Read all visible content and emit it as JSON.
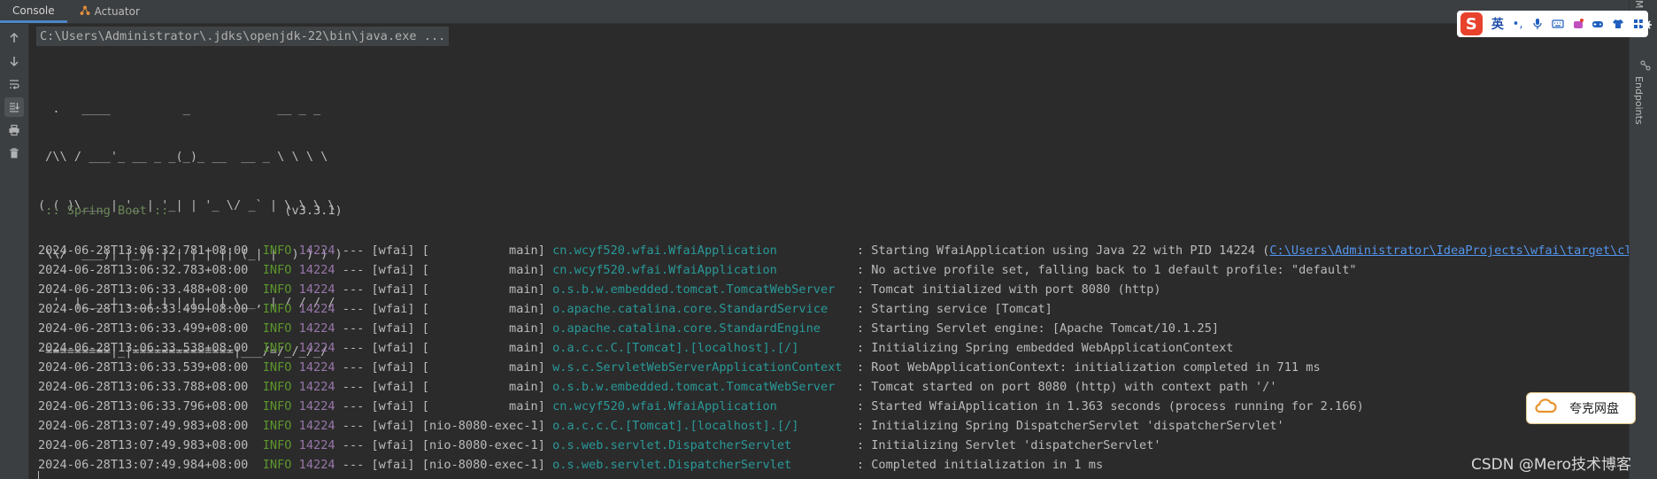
{
  "tabs": [
    {
      "label": "Console",
      "active": true
    },
    {
      "label": "Actuator",
      "active": false
    }
  ],
  "command_line": "C:\\Users\\Administrator\\.jdks\\openjdk-22\\bin\\java.exe ...",
  "banner": [
    "  .   ____          _            __ _ _",
    " /\\\\ / ___'_ __ _ _(_)_ __  __ _ \\ \\ \\ \\",
    "( ( )\\___ | '_ | '_| | '_ \\/ _` | \\ \\ \\ \\",
    " \\\\/  ___)| |_)| | | | | || (_| |  ) ) ) )",
    "  '  |____| .__|_| |_|_| |_\\__, | / / / /",
    " =========|_|==============|___/=/_/_/_/"
  ],
  "spring_boot": {
    "label": " :: Spring Boot :: ",
    "version": "               (v3.3.1)"
  },
  "logs": [
    {
      "ts": "2024-06-28T13:06:32.781+08:00",
      "level": "INFO",
      "pid": "14224",
      "sep": " --- [wfai] [",
      "thread": "           main] ",
      "logger": "cn.wcyf520.wfai.WfaiApplication          ",
      "msg": " : Starting WfaiApplication using Java 22 with PID 14224 (",
      "link": "C:\\Users\\Administrator\\IdeaProjects\\wfai\\target\\classes",
      "tail": " s"
    },
    {
      "ts": "2024-06-28T13:06:32.783+08:00",
      "level": "INFO",
      "pid": "14224",
      "sep": " --- [wfai] [",
      "thread": "           main] ",
      "logger": "cn.wcyf520.wfai.WfaiApplication          ",
      "msg": " : No active profile set, falling back to 1 default profile: \"default\"",
      "link": "",
      "tail": ""
    },
    {
      "ts": "2024-06-28T13:06:33.488+08:00",
      "level": "INFO",
      "pid": "14224",
      "sep": " --- [wfai] [",
      "thread": "           main] ",
      "logger": "o.s.b.w.embedded.tomcat.TomcatWebServer  ",
      "msg": " : Tomcat initialized with port 8080 (http)",
      "link": "",
      "tail": ""
    },
    {
      "ts": "2024-06-28T13:06:33.499+08:00",
      "level": "INFO",
      "pid": "14224",
      "sep": " --- [wfai] [",
      "thread": "           main] ",
      "logger": "o.apache.catalina.core.StandardService   ",
      "msg": " : Starting service [Tomcat]",
      "link": "",
      "tail": ""
    },
    {
      "ts": "2024-06-28T13:06:33.499+08:00",
      "level": "INFO",
      "pid": "14224",
      "sep": " --- [wfai] [",
      "thread": "           main] ",
      "logger": "o.apache.catalina.core.StandardEngine    ",
      "msg": " : Starting Servlet engine: [Apache Tomcat/10.1.25]",
      "link": "",
      "tail": ""
    },
    {
      "ts": "2024-06-28T13:06:33.538+08:00",
      "level": "INFO",
      "pid": "14224",
      "sep": " --- [wfai] [",
      "thread": "           main] ",
      "logger": "o.a.c.c.C.[Tomcat].[localhost].[/]       ",
      "msg": " : Initializing Spring embedded WebApplicationContext",
      "link": "",
      "tail": ""
    },
    {
      "ts": "2024-06-28T13:06:33.539+08:00",
      "level": "INFO",
      "pid": "14224",
      "sep": " --- [wfai] [",
      "thread": "           main] ",
      "logger": "w.s.c.ServletWebServerApplicationContext ",
      "msg": " : Root WebApplicationContext: initialization completed in 711 ms",
      "link": "",
      "tail": ""
    },
    {
      "ts": "2024-06-28T13:06:33.788+08:00",
      "level": "INFO",
      "pid": "14224",
      "sep": " --- [wfai] [",
      "thread": "           main] ",
      "logger": "o.s.b.w.embedded.tomcat.TomcatWebServer  ",
      "msg": " : Tomcat started on port 8080 (http) with context path '/'",
      "link": "",
      "tail": ""
    },
    {
      "ts": "2024-06-28T13:06:33.796+08:00",
      "level": "INFO",
      "pid": "14224",
      "sep": " --- [wfai] [",
      "thread": "           main] ",
      "logger": "cn.wcyf520.wfai.WfaiApplication          ",
      "msg": " : Started WfaiApplication in 1.363 seconds (process running for 2.166)",
      "link": "",
      "tail": ""
    },
    {
      "ts": "2024-06-28T13:07:49.983+08:00",
      "level": "INFO",
      "pid": "14224",
      "sep": " --- [wfai] [",
      "thread": "nio-8080-exec-1] ",
      "logger": "o.a.c.c.C.[Tomcat].[localhost].[/]       ",
      "msg": " : Initializing Spring DispatcherServlet 'dispatcherServlet'",
      "link": "",
      "tail": ""
    },
    {
      "ts": "2024-06-28T13:07:49.983+08:00",
      "level": "INFO",
      "pid": "14224",
      "sep": " --- [wfai] [",
      "thread": "nio-8080-exec-1] ",
      "logger": "o.s.web.servlet.DispatcherServlet        ",
      "msg": " : Initializing Servlet 'dispatcherServlet'",
      "link": "",
      "tail": ""
    },
    {
      "ts": "2024-06-28T13:07:49.984+08:00",
      "level": "INFO",
      "pid": "14224",
      "sep": " --- [wfai] [",
      "thread": "nio-8080-exec-1] ",
      "logger": "o.s.web.servlet.DispatcherServlet        ",
      "msg": " : Completed initialization in 1 ms",
      "link": "",
      "tail": ""
    }
  ],
  "right_panel": {
    "top_label": "M",
    "endpoints_label": "Endpoints"
  },
  "ime": {
    "logo": "S",
    "lang": "英",
    "punct": "•,"
  },
  "cloud_widget": {
    "label": "夸克网盘"
  },
  "watermark": "CSDN @Mero技术博客",
  "colors": {
    "info": "#5c962c",
    "pid": "#9876aa",
    "logger": "#299999",
    "link": "#5394ec",
    "spring": "#6a8759"
  }
}
